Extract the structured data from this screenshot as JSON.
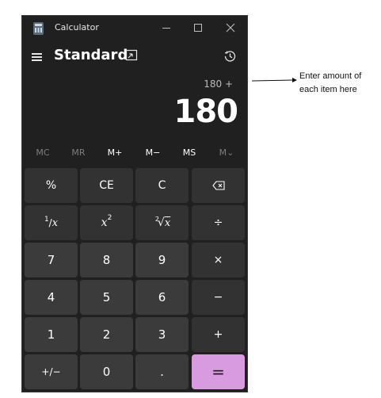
{
  "app": {
    "title": "Calculator"
  },
  "header": {
    "mode": "Standard",
    "keep_on_top_icon": "keep-on-top-icon",
    "history_icon": "history-icon"
  },
  "display": {
    "expression": "180 +",
    "value": "180"
  },
  "memory": [
    {
      "label": "MC",
      "enabled": false
    },
    {
      "label": "MR",
      "enabled": false
    },
    {
      "label": "M+",
      "enabled": true
    },
    {
      "label": "M−",
      "enabled": true
    },
    {
      "label": "MS",
      "enabled": true
    },
    {
      "label": "M⌄",
      "enabled": false
    }
  ],
  "keys": {
    "percent": "%",
    "clear_entry": "CE",
    "clear": "C",
    "reciprocal_num": "1",
    "reciprocal_den": "x",
    "square_base": "x",
    "square_exp": "2",
    "sqrt_index": "2",
    "sqrt_arg": "x",
    "divide": "÷",
    "seven": "7",
    "eight": "8",
    "nine": "9",
    "multiply": "×",
    "four": "4",
    "five": "5",
    "six": "6",
    "subtract": "−",
    "one": "1",
    "two": "2",
    "three": "3",
    "add": "+",
    "negate": "+/−",
    "zero": "0",
    "decimal": ".",
    "equals": "="
  },
  "annotation": {
    "text": "Enter amount of each item here"
  },
  "colors": {
    "background": "#202020",
    "key": "#3b3b3b",
    "accent": "#d99be0"
  }
}
